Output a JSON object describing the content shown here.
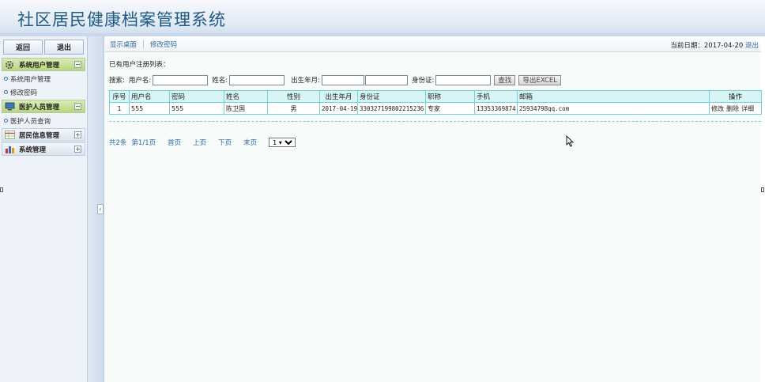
{
  "app": {
    "title": "社区居民健康档案管理系统"
  },
  "sidebar": {
    "top_buttons": {
      "back": "返回",
      "logout": "退出"
    },
    "groups": [
      {
        "label": "系统用户管理",
        "icon": "gear-icon",
        "state": "expanded",
        "toggle": "−",
        "items": [
          {
            "label": "系统用户管理"
          },
          {
            "label": "修改密码"
          }
        ]
      },
      {
        "label": "医护人员管理",
        "icon": "monitor-icon",
        "state": "expanded",
        "toggle": "−",
        "items": [
          {
            "label": "医护人员查询"
          }
        ]
      },
      {
        "label": "居民信息管理",
        "icon": "table-icon",
        "state": "collapsed",
        "toggle": "+",
        "items": []
      },
      {
        "label": "系统管理",
        "icon": "bar-chart-icon",
        "state": "collapsed",
        "toggle": "+",
        "items": []
      }
    ],
    "collapse_handle": "‹"
  },
  "topbar": {
    "tabs": [
      {
        "label": "显示桌面"
      },
      {
        "label": "修改密码"
      }
    ],
    "date_label": "当前日期：2017-04-20",
    "logout_link": "退出"
  },
  "main": {
    "section_title": "已有用户注册列表：",
    "search": {
      "prefix": "搜索:",
      "username_label": "用户名:",
      "name_label": "姓名:",
      "birth_label": "出生年月:",
      "idcard_label": "身份证:",
      "username_value": "",
      "name_value": "",
      "birth_from_value": "",
      "birth_to_value": "",
      "idcard_value": "",
      "search_button": "查找",
      "export_button": "导出EXCEL"
    },
    "table": {
      "headers": [
        "序号",
        "用户名",
        "密码",
        "姓名",
        "性别",
        "出生年月",
        "身份证",
        "职称",
        "手机",
        "邮箱",
        "操作"
      ],
      "rows": [
        {
          "index": "1",
          "username": "555",
          "password": "555",
          "name": "陈卫国",
          "gender": "男",
          "birth": "2017-04-19",
          "idcard": "330327199802215236",
          "title": "专家",
          "phone": "13353369874",
          "email": "25934798qq.com",
          "ops": {
            "edit": "修改",
            "delete": "删除",
            "detail": "详细"
          }
        }
      ]
    },
    "pager": {
      "total": "共2条",
      "page_info": "第1/1页",
      "first": "首页",
      "prev": "上页",
      "next": "下页",
      "last": "末页",
      "selected_page": "1 ▾"
    }
  },
  "colors": {
    "title": "#1d5a8c",
    "link": "#2f6aa6",
    "grid_border": "#6fd3dd",
    "grid_header": "#d8f5f6",
    "active_group": "#b6d77d"
  }
}
